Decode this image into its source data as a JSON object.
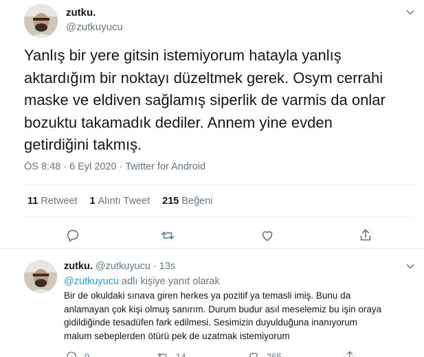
{
  "main_tweet": {
    "display_name": "zutku.",
    "handle": "@zutkuyucu",
    "text": "Yanlış bir yere gitsin istemiyorum hatayla yanlış\naktardığım bir noktayı düzeltmek gerek. Osym cerrahi\nmaske ve eldiven sağlamış siperlik de varmis da onlar\nbozuktu takamadık dediler. Annem yine evden\ngetirdiğini takmış.",
    "timestamp": "ÖS 8:48 · 6 Eyl 2020 · Twitter for Android",
    "stats": {
      "retweet_count": "11",
      "retweet_label": "Retweet",
      "quote_count": "1",
      "quote_label": "Alıntı Tweet",
      "like_count": "215",
      "like_label": "Beğeni"
    },
    "actions": [
      "reply-icon",
      "retweet-icon",
      "like-icon",
      "share-icon"
    ]
  },
  "reply_tweet": {
    "display_name": "zutku.",
    "handle": "@zutkuyucu",
    "time": "· 13s",
    "reply_to_mention": "@zutkuyucu",
    "reply_to_suffix": " adlı kişiye yanıt olarak",
    "text": "Bir de okuldaki sınava giren herkes ya pozitif ya temasli imiş. Bunu da\nanlamayan çok kişi olmuş sanırım. Durum budur asıl meselemiz bu işin oraya\ngidildiğinde tesadüfen fark edilmesi. Sesimizin duyulduğuna inanıyorum\nmalum sebeplerden ötürü pek de uzatmak istemiyorum",
    "counts": {
      "replies": "9",
      "retweets": "14",
      "likes": "265"
    }
  },
  "colors": {
    "text": "#14171a",
    "secondary": "#657786",
    "accent": "#1da1f2",
    "border": "#e6ecf0"
  }
}
